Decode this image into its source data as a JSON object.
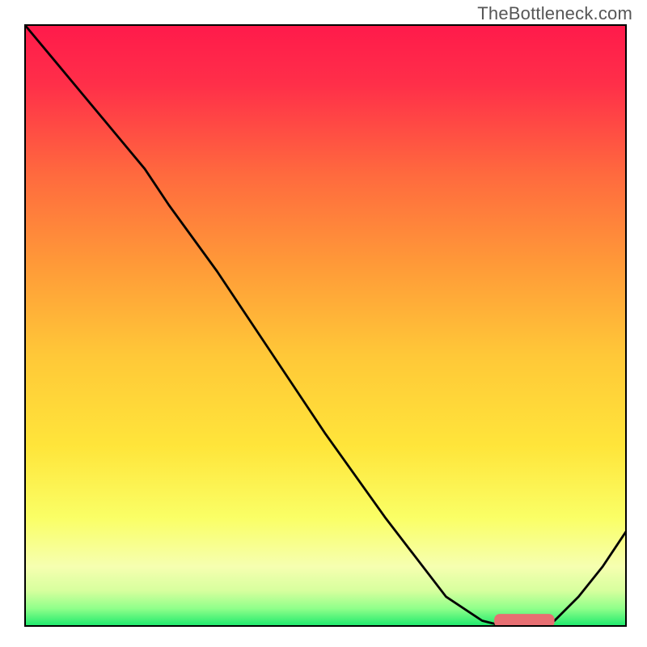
{
  "attribution": "TheBottleneck.com",
  "colors": {
    "curve": "#000000",
    "marker": "#e76f72",
    "gradient_top": "#ff1a4b",
    "gradient_bottom": "#17e86b"
  },
  "chart_data": {
    "type": "line",
    "title": "",
    "xlabel": "",
    "ylabel": "",
    "xlim": [
      0,
      100
    ],
    "ylim": [
      0,
      100
    ],
    "x": [
      0,
      5,
      10,
      15,
      20,
      24,
      28,
      32,
      40,
      50,
      60,
      70,
      76,
      80,
      84,
      88,
      92,
      96,
      100
    ],
    "values": [
      100,
      94,
      88,
      82,
      76,
      70,
      64.5,
      59,
      47,
      32,
      18,
      5,
      1,
      0,
      0,
      1,
      5,
      10,
      16
    ],
    "marker": {
      "x_start": 78,
      "x_end": 88,
      "y": 0,
      "height": 2
    }
  }
}
